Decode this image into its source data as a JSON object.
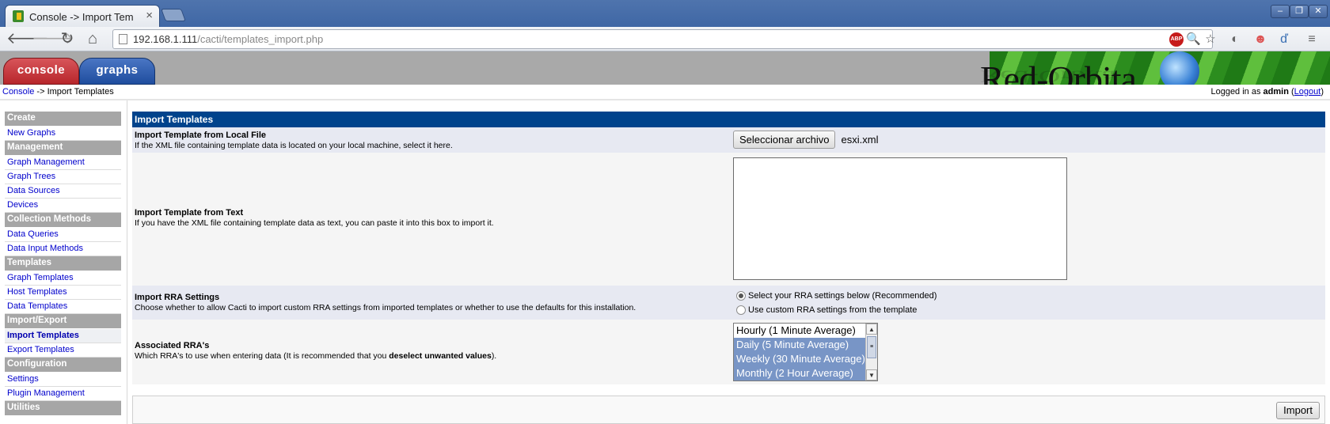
{
  "browser": {
    "tab_title": "Console -> Import Tem",
    "tab_close": "×",
    "url_host": "192.168.1.111",
    "url_path": "/cacti/templates_import.php",
    "window_buttons": [
      "–",
      "❐",
      "✕"
    ],
    "abp_label": "ABP"
  },
  "header": {
    "tabs": [
      "console",
      "graphs"
    ],
    "logo_text": "Red-Orbita"
  },
  "breadcrumb": {
    "console": "Console",
    "separator": " -> ",
    "current": "Import Templates"
  },
  "login": {
    "prefix": "Logged in as ",
    "user": "admin",
    "logout": "Logout"
  },
  "sidebar": [
    {
      "type": "head",
      "label": "Create"
    },
    {
      "type": "item",
      "label": "New Graphs"
    },
    {
      "type": "head",
      "label": "Management"
    },
    {
      "type": "item",
      "label": "Graph Management"
    },
    {
      "type": "item",
      "label": "Graph Trees"
    },
    {
      "type": "item",
      "label": "Data Sources"
    },
    {
      "type": "item",
      "label": "Devices"
    },
    {
      "type": "head",
      "label": "Collection Methods"
    },
    {
      "type": "item",
      "label": "Data Queries"
    },
    {
      "type": "item",
      "label": "Data Input Methods"
    },
    {
      "type": "head",
      "label": "Templates"
    },
    {
      "type": "item",
      "label": "Graph Templates"
    },
    {
      "type": "item",
      "label": "Host Templates"
    },
    {
      "type": "item",
      "label": "Data Templates"
    },
    {
      "type": "head",
      "label": "Import/Export"
    },
    {
      "type": "item",
      "label": "Import Templates",
      "active": true
    },
    {
      "type": "item",
      "label": "Export Templates"
    },
    {
      "type": "head",
      "label": "Configuration"
    },
    {
      "type": "item",
      "label": "Settings"
    },
    {
      "type": "item",
      "label": "Plugin Management"
    },
    {
      "type": "head",
      "label": "Utilities"
    }
  ],
  "form": {
    "title": "Import Templates",
    "local_file": {
      "title": "Import Template from Local File",
      "desc": "If the XML file containing template data is located on your local machine, select it here.",
      "button": "Seleccionar archivo",
      "filename": "esxi.xml"
    },
    "from_text": {
      "title": "Import Template from Text",
      "desc": "If you have the XML file containing template data as text, you can paste it into this box to import it.",
      "value": ""
    },
    "rra_settings": {
      "title": "Import RRA Settings",
      "desc": "Choose whether to allow Cacti to import custom RRA settings from imported templates or whether to use the defaults for this installation.",
      "options": [
        "Select your RRA settings below (Recommended)",
        "Use custom RRA settings from the template"
      ],
      "selected": 0
    },
    "rras": {
      "title": "Associated RRA's",
      "desc_before": "Which RRA's to use when entering data (It is recommended that you ",
      "desc_bold": "deselect unwanted values",
      "desc_after": ").",
      "options": [
        {
          "label": "Hourly (1 Minute Average)",
          "selected": false
        },
        {
          "label": "Daily (5 Minute Average)",
          "selected": true
        },
        {
          "label": "Weekly (30 Minute Average)",
          "selected": true
        },
        {
          "label": "Monthly (2 Hour Average)",
          "selected": true
        }
      ]
    },
    "import_button": "Import"
  }
}
